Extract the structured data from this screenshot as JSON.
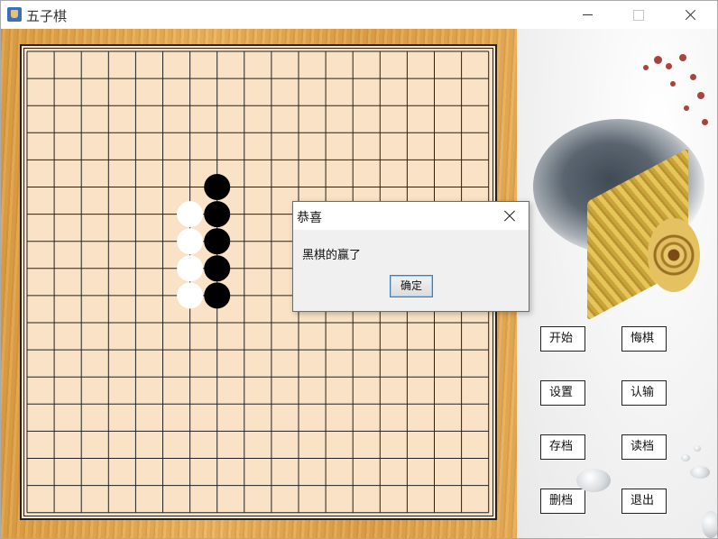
{
  "window": {
    "title": "五子棋"
  },
  "board": {
    "lines": 18,
    "stones": [
      {
        "color": "black",
        "col": 7,
        "row": 5
      },
      {
        "color": "black",
        "col": 7,
        "row": 6
      },
      {
        "color": "black",
        "col": 7,
        "row": 7
      },
      {
        "color": "black",
        "col": 7,
        "row": 8
      },
      {
        "color": "black",
        "col": 7,
        "row": 9
      },
      {
        "color": "white",
        "col": 6,
        "row": 6
      },
      {
        "color": "white",
        "col": 6,
        "row": 7
      },
      {
        "color": "white",
        "col": 6,
        "row": 8
      },
      {
        "color": "white",
        "col": 6,
        "row": 9
      }
    ]
  },
  "sidebar": {
    "buttons": {
      "start": "开始",
      "undo": "悔棋",
      "settings": "设置",
      "resign": "认输",
      "save": "存档",
      "load": "读档",
      "delete": "删档",
      "exit": "退出"
    }
  },
  "dialog": {
    "title": "恭喜",
    "message": "黑棋的赢了",
    "ok": "确定"
  },
  "colors": {
    "board": "#f9e2c6",
    "frame": "#e2a852",
    "black_stone": "#000000",
    "white_stone": "#ffffff"
  }
}
